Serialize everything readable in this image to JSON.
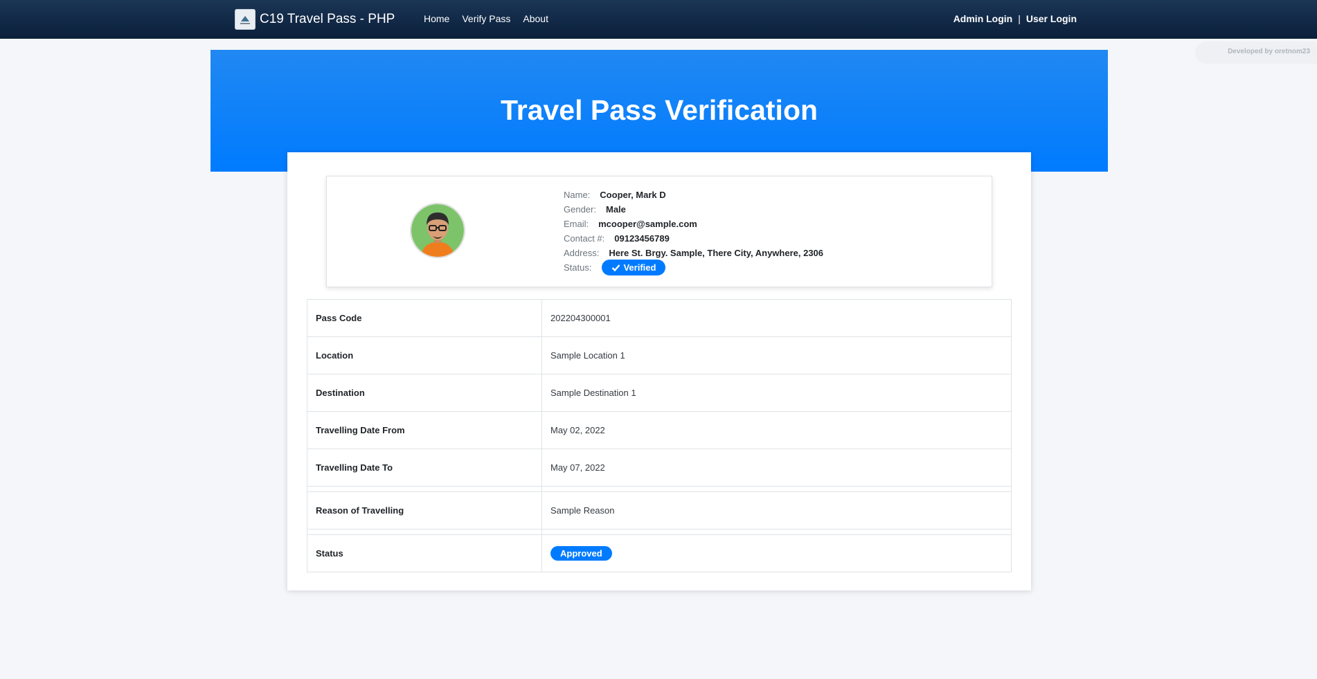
{
  "navbar": {
    "title": "C19 Travel Pass - PHP",
    "links": [
      "Home",
      "Verify Pass",
      "About"
    ],
    "admin_login": "Admin Login",
    "separator": "|",
    "user_login": "User Login"
  },
  "credit": "Developed by oretnom23",
  "hero": {
    "title": "Travel Pass Verification"
  },
  "profile": {
    "name_label": "Name:",
    "name": "Cooper, Mark D",
    "gender_label": "Gender:",
    "gender": "Male",
    "email_label": "Email:",
    "email": "mcooper@sample.com",
    "contact_label": "Contact #:",
    "contact": "09123456789",
    "address_label": "Address:",
    "address": "Here St. Brgy. Sample, There City, Anywhere, 2306",
    "status_label": "Status:",
    "status": "Verified"
  },
  "details": [
    {
      "label": "Pass Code",
      "value": "202204300001"
    },
    {
      "label": "Location",
      "value": "Sample Location 1"
    },
    {
      "label": "Destination",
      "value": "Sample Destination 1"
    },
    {
      "label": "Travelling Date From",
      "value": "May 02, 2022"
    },
    {
      "label": "Travelling Date To",
      "value": "May 07, 2022"
    },
    {
      "label": "Reason of Travelling",
      "value": "Sample Reason"
    },
    {
      "label": "Status",
      "value": "Approved"
    }
  ],
  "colors": {
    "navbar": "#0a1f3a",
    "accent": "#007bff",
    "background": "#f4f6f9"
  }
}
